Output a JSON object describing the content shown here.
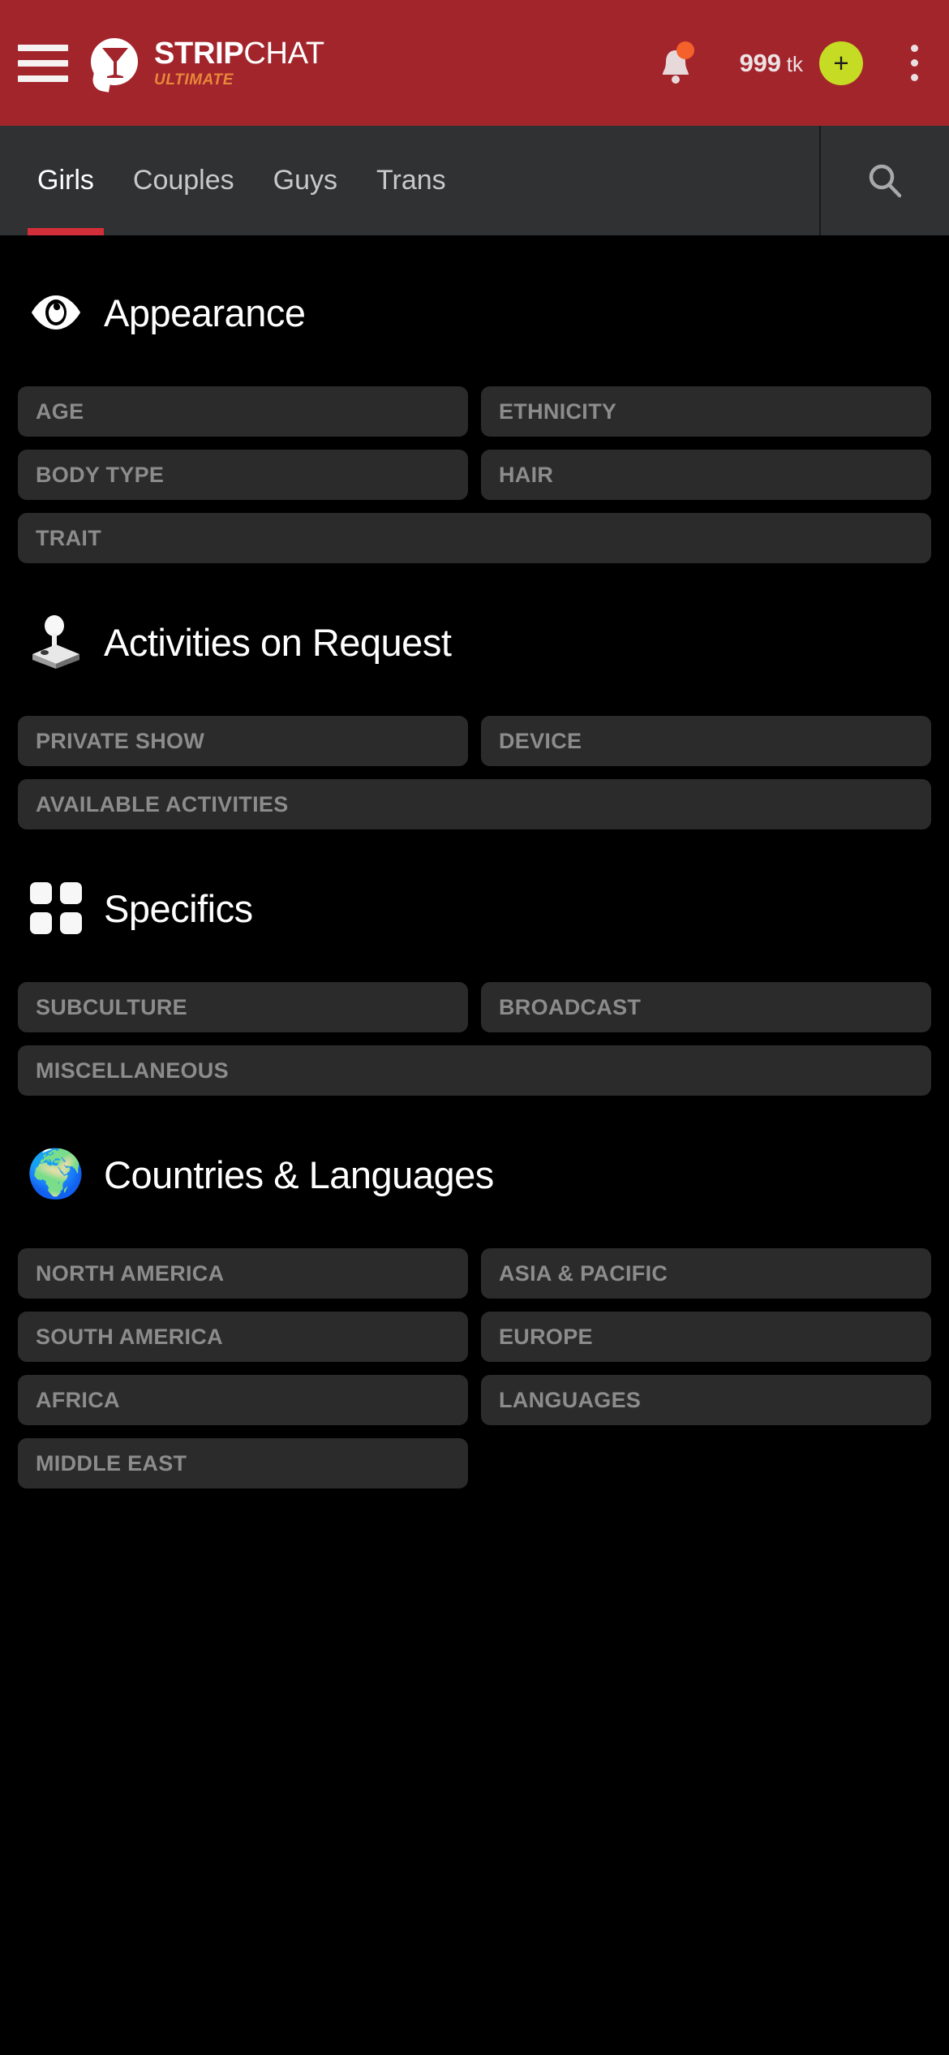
{
  "header": {
    "menu_icon": "hamburger-menu-icon",
    "logo": {
      "icon": "speech-bubble-martini-logo",
      "name_bold": "STRIP",
      "name_light": "CHAT",
      "tagline": "ULTIMATE",
      "tagline_color": "#E8883A"
    },
    "notifications": {
      "icon": "bell-icon",
      "has_badge": true,
      "badge_color": "#F4612A"
    },
    "tokens": {
      "amount": "999",
      "unit": "tk"
    },
    "add_tokens": {
      "label": "+",
      "color": "#C6DB24"
    },
    "more_icon": "kebab-menu-icon",
    "background_color": "#A3252C"
  },
  "nav": {
    "tabs": [
      {
        "label": "Girls",
        "active": true
      },
      {
        "label": "Couples",
        "active": false
      },
      {
        "label": "Guys",
        "active": false
      },
      {
        "label": "Trans",
        "active": false
      }
    ],
    "search_icon": "search-icon",
    "active_underline_color": "#D32F3A",
    "background_color": "#2F3133"
  },
  "sections": [
    {
      "title": "Appearance",
      "icon": "eye-icon",
      "chips": [
        {
          "label": "AGE",
          "width": "half"
        },
        {
          "label": "ETHNICITY",
          "width": "half"
        },
        {
          "label": "BODY TYPE",
          "width": "half"
        },
        {
          "label": "HAIR",
          "width": "half"
        },
        {
          "label": "TRAIT",
          "width": "full"
        }
      ]
    },
    {
      "title": "Activities on Request",
      "icon": "joystick-icon",
      "chips": [
        {
          "label": "PRIVATE SHOW",
          "width": "half"
        },
        {
          "label": "DEVICE",
          "width": "half"
        },
        {
          "label": "AVAILABLE ACTIVITIES",
          "width": "full"
        }
      ]
    },
    {
      "title": "Specifics",
      "icon": "grid-four-squares-icon",
      "chips": [
        {
          "label": "SUBCULTURE",
          "width": "half"
        },
        {
          "label": "BROADCAST",
          "width": "half"
        },
        {
          "label": "MISCELLANEOUS",
          "width": "full"
        }
      ]
    },
    {
      "title": "Countries & Languages",
      "icon": "globe-icon",
      "icon_glyph": "🌍",
      "chips": [
        {
          "label": "NORTH AMERICA",
          "width": "half"
        },
        {
          "label": "ASIA & PACIFIC",
          "width": "half"
        },
        {
          "label": "SOUTH AMERICA",
          "width": "half"
        },
        {
          "label": "EUROPE",
          "width": "half"
        },
        {
          "label": "AFRICA",
          "width": "half"
        },
        {
          "label": "LANGUAGES",
          "width": "half"
        },
        {
          "label": "MIDDLE EAST",
          "width": "half"
        }
      ]
    }
  ],
  "theme": {
    "page_background": "#000000",
    "chip_background": "#2B2B2B",
    "chip_text": "#8C8C8C",
    "section_title": "#FFFFFF"
  }
}
